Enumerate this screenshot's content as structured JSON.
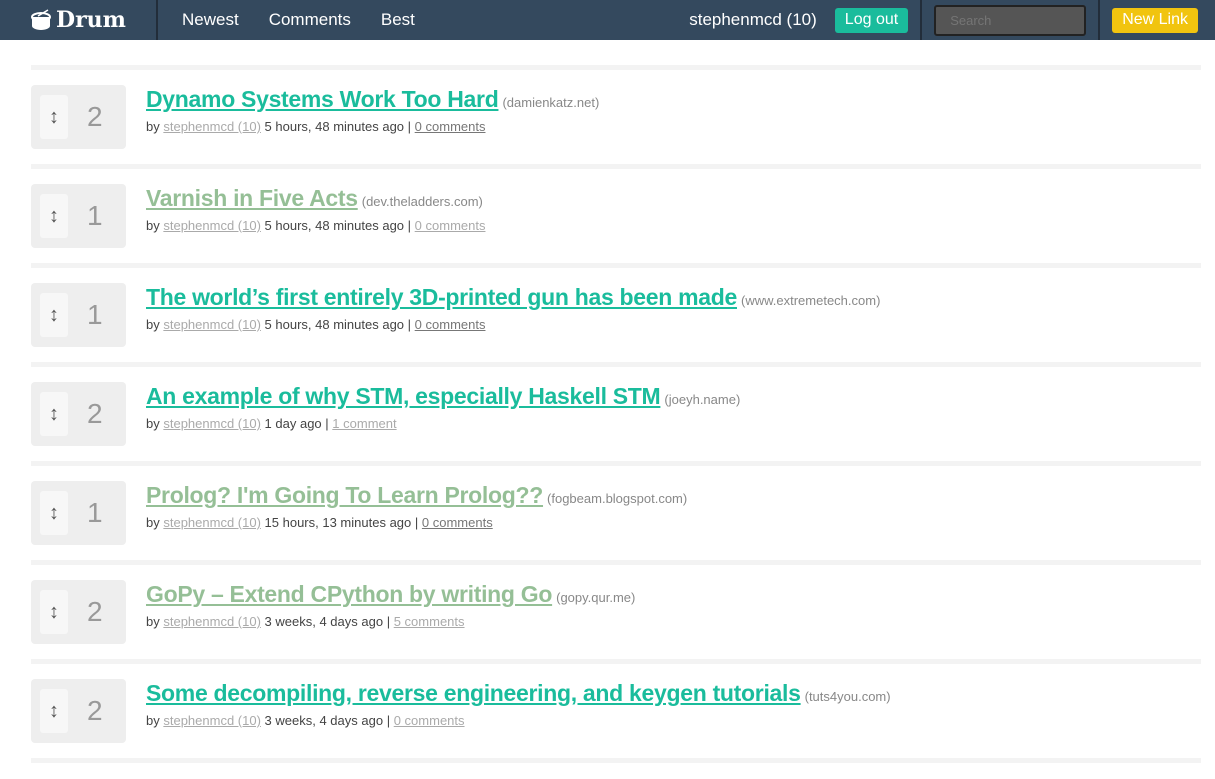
{
  "nav": {
    "brand": "Drum",
    "links": [
      "Newest",
      "Comments",
      "Best"
    ],
    "user": "stephenmcd (10)",
    "logout": "Log out",
    "search_placeholder": "Search",
    "new_link": "New Link"
  },
  "items": [
    {
      "score": "2",
      "title": "Dynamo Systems Work Too Hard",
      "domain": "(damienkatz.net)",
      "by": "by",
      "author": "stephenmcd (10)",
      "time": "5 hours, 48 minutes ago",
      "sep": "|",
      "comments": "0 comments",
      "visited": false,
      "cvisited": false
    },
    {
      "score": "1",
      "title": "Varnish in Five Acts",
      "domain": "(dev.theladders.com)",
      "by": "by",
      "author": "stephenmcd (10)",
      "time": "5 hours, 48 minutes ago",
      "sep": "|",
      "comments": "0 comments",
      "visited": true,
      "cvisited": true
    },
    {
      "score": "1",
      "title": "The world’s first entirely 3D-printed gun has been made",
      "domain": "(www.extremetech.com)",
      "by": "by",
      "author": "stephenmcd (10)",
      "time": "5 hours, 48 minutes ago",
      "sep": "|",
      "comments": "0 comments",
      "visited": false,
      "cvisited": false
    },
    {
      "score": "2",
      "title": "An example of why STM, especially Haskell STM",
      "domain": "(joeyh.name)",
      "by": "by",
      "author": "stephenmcd (10)",
      "time": "1 day ago",
      "sep": "|",
      "comments": "1 comment",
      "visited": false,
      "cvisited": true
    },
    {
      "score": "1",
      "title": "Prolog? I'm Going To Learn Prolog??",
      "domain": "(fogbeam.blogspot.com)",
      "by": "by",
      "author": "stephenmcd (10)",
      "time": "15 hours, 13 minutes ago",
      "sep": "|",
      "comments": "0 comments",
      "visited": true,
      "cvisited": false
    },
    {
      "score": "2",
      "title": "GoPy – Extend CPython by writing Go",
      "domain": "(gopy.qur.me)",
      "by": "by",
      "author": "stephenmcd (10)",
      "time": "3 weeks, 4 days ago",
      "sep": "|",
      "comments": "5 comments",
      "visited": true,
      "cvisited": true
    },
    {
      "score": "2",
      "title": "Some decompiling, reverse engineering, and keygen tutorials",
      "domain": "(tuts4you.com)",
      "by": "by",
      "author": "stephenmcd (10)",
      "time": "3 weeks, 4 days ago",
      "sep": "|",
      "comments": "0 comments",
      "visited": false,
      "cvisited": true
    }
  ]
}
